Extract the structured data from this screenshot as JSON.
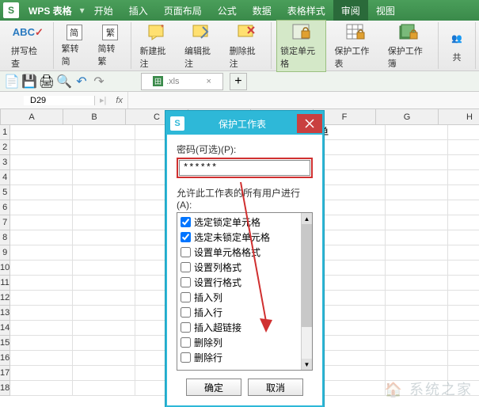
{
  "app": {
    "logo": "S",
    "name": "WPS 表格"
  },
  "menu": {
    "items": [
      "开始",
      "插入",
      "页面布局",
      "公式",
      "数据",
      "表格样式",
      "审阅",
      "视图"
    ],
    "active_index": 6
  },
  "ribbon": {
    "spellcheck": "拼写检查",
    "simp2trad": "繁转简",
    "trad2simp": "简转繁",
    "simp_char": "简",
    "trad_char": "繁",
    "new_comment": "新建批注",
    "edit_comment": "编辑批注",
    "del_comment": "删除批注",
    "lock_cell": "锁定单元格",
    "protect_sheet": "保护工作表",
    "protect_book": "保护工作簿",
    "share": "共"
  },
  "file_tab": {
    "name": ".xls"
  },
  "formula": {
    "cell_ref": "D29",
    "fx": "fx"
  },
  "columns": [
    "A",
    "B",
    "C",
    "D",
    "E",
    "F",
    "G",
    "H"
  ],
  "rows_count": 18,
  "cell_text": "管理人员名单",
  "dialog": {
    "title": "保护工作表",
    "pwd_label": "密码(可选)(P):",
    "pwd_value": "******",
    "perm_label": "允许此工作表的所有用户进行(A):",
    "permissions": [
      {
        "label": "选定锁定单元格",
        "checked": true
      },
      {
        "label": "选定未锁定单元格",
        "checked": true
      },
      {
        "label": "设置单元格格式",
        "checked": false
      },
      {
        "label": "设置列格式",
        "checked": false
      },
      {
        "label": "设置行格式",
        "checked": false
      },
      {
        "label": "插入列",
        "checked": false
      },
      {
        "label": "插入行",
        "checked": false
      },
      {
        "label": "插入超链接",
        "checked": false
      },
      {
        "label": "删除列",
        "checked": false
      },
      {
        "label": "删除行",
        "checked": false
      }
    ],
    "ok": "确定",
    "cancel": "取消"
  },
  "watermark": "系统之家"
}
